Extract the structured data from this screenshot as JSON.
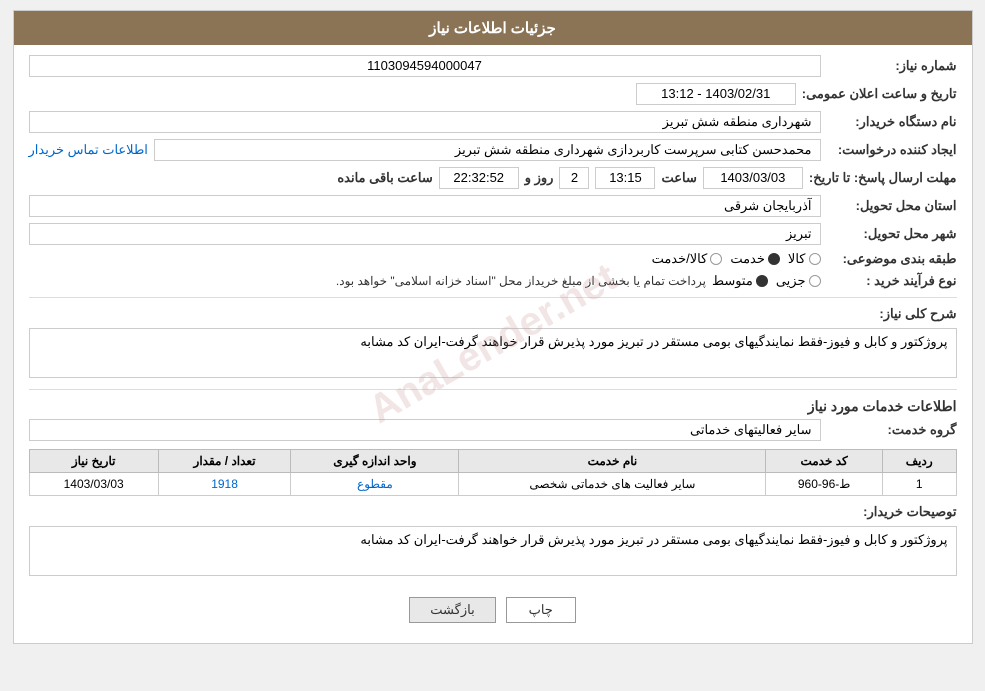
{
  "header": {
    "title": "جزئیات اطلاعات نیاز"
  },
  "fields": {
    "shomareNiaz_label": "شماره نیاز:",
    "shomareNiaz_value": "1103094594000047",
    "namDastgah_label": "نام دستگاه خریدار:",
    "namDastgah_value": "شهرداری منطقه شش تبریز",
    "ijadKonande_label": "ایجاد کننده درخواست:",
    "ijadKonande_value": "محمدحسن کتابی سرپرست کاربردازی شهرداری منطقه شش تبریز",
    "ijadKonande_link": "اطلاعات تماس خریدار",
    "tarikh_label": "مهلت ارسال پاسخ: تا تاریخ:",
    "tarikh_date": "1403/03/03",
    "tarikh_saat_label": "ساعت",
    "tarikh_saat": "13:15",
    "tarikh_roz_label": "روز و",
    "tarikh_roz": "2",
    "tarikh_remaining_label": "ساعت باقی مانده",
    "tarikh_remaining": "22:32:52",
    "ostan_label": "استان محل تحویل:",
    "ostan_value": "آذربایجان شرقی",
    "shahr_label": "شهر محل تحویل:",
    "shahr_value": "تبریز",
    "tabaghe_label": "طبقه بندی موضوعی:",
    "tabaghe_options": [
      "کالا",
      "خدمت",
      "کالا/خدمت"
    ],
    "tabaghe_selected": "خدمت",
    "noeFarayand_label": "نوع فرآیند خرید :",
    "noeFarayand_options": [
      "جزیی",
      "متوسط"
    ],
    "noeFarayand_selected": "متوسط",
    "noeFarayand_note": "پرداخت تمام یا بخشی از مبلغ خریداز محل \"اسناد خزانه اسلامی\" خواهد بود.",
    "tarikh_elaan_label": "تاریخ و ساعت اعلان عمومی:",
    "tarikh_elaan_value": "1403/02/31 - 13:12",
    "sharhKoli_label": "شرح کلی نیاز:",
    "sharhKoli_value": "پروژکتور و کابل و فیوز-فقط نمایندگیهای بومی مستقر در تبریز مورد پذیرش قرار خواهند گرفت-ایران کد مشابه",
    "khadamat_label": "اطلاعات خدمات مورد نیاز",
    "groheKhadamat_label": "گروه خدمت:",
    "groheKhadamat_value": "سایر فعالیتهای خدماتی",
    "table": {
      "headers": [
        "ردیف",
        "کد خدمت",
        "نام خدمت",
        "واحد اندازه گیری",
        "تعداد / مقدار",
        "تاریخ نیاز"
      ],
      "rows": [
        {
          "radif": "1",
          "kod": "ط-96-960",
          "nam": "سایر فعالیت های خدماتی شخصی",
          "vahed": "مقطوع",
          "tedad": "1918",
          "tarikh": "1403/03/03"
        }
      ]
    },
    "tosifat_label": "توصیحات خریدار:",
    "tosifat_value": "پروژکتور و کابل و فیوز-فقط نمایندگیهای بومی مستقر در تبریز مورد پذیرش قرار خواهند گرفت-ایران کد مشابه"
  },
  "buttons": {
    "print": "چاپ",
    "back": "بازگشت"
  }
}
